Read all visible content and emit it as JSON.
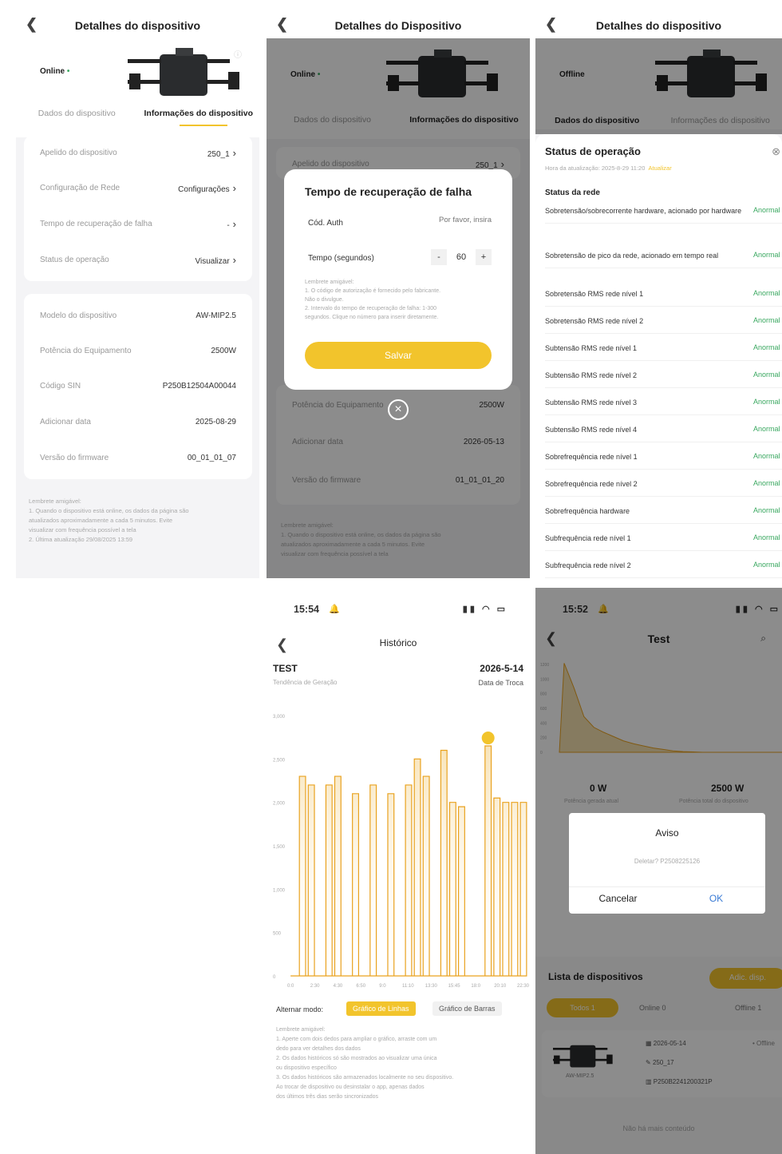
{
  "panel1": {
    "title": "Detalhes do dispositivo",
    "status": "Online",
    "tabs": [
      "Dados do dispositivo",
      "Informações do dispositivo"
    ],
    "rows1": [
      {
        "label": "Apelido do dispositivo",
        "value": "250_1"
      },
      {
        "label": "Configuração de Rede",
        "value": "Configurações"
      },
      {
        "label": "Tempo de recuperação de falha",
        "value": "-"
      },
      {
        "label": "Status de operação",
        "value": "Visualizar"
      }
    ],
    "rows2": [
      {
        "label": "Modelo do dispositivo",
        "value": "AW-MIP2.5"
      },
      {
        "label": "Potência do Equipamento",
        "value": "2500W"
      },
      {
        "label": "Código SIN",
        "value": "P250B12504A00044"
      },
      {
        "label": "Adicionar data",
        "value": "2025-08-29"
      },
      {
        "label": "Versão do firmware",
        "value": "00_01_01_07"
      }
    ],
    "hint_title": "Lembrete amigável:",
    "hint_lines": [
      "1. Quando o dispositivo está online, os dados da página são",
      "atualizados aproximadamente a cada 5 minutos. Evite",
      "visualizar com frequência possível a tela",
      "2. Última atualização 29/08/2025 13:59"
    ]
  },
  "panel2": {
    "title": "Detalhes do Dispositivo",
    "status": "Online",
    "tabs": [
      "Dados do dispositivo",
      "Informações do dispositivo"
    ],
    "bg_row": {
      "label": "Apelido do dispositivo",
      "value": "250_1"
    },
    "modal": {
      "title": "Tempo de recuperação de falha",
      "auth_label": "Cód. Auth",
      "auth_placeholder": "Por favor, insira",
      "time_label": "Tempo (segundos)",
      "time_value": "60",
      "minus": "-",
      "plus": "+",
      "hint_lines": [
        "Lembrete amigável:",
        "1. O código de autorização é fornecido pelo fabricante.",
        "Não o divulgue.",
        "2. Intervalo do tempo de recuperação de falha: 1-300",
        "segundos. Clique no número para inserir diretamente."
      ],
      "save": "Salvar"
    },
    "bg_rows": [
      {
        "label": "Potência do Equipamento",
        "value": "2500W"
      },
      {
        "label": "Adicionar data",
        "value": "2026-05-13"
      },
      {
        "label": "Versão do firmware",
        "value": "01_01_01_20"
      }
    ],
    "hint_lines": [
      "Lembrete amigável:",
      "1. Quando o dispositivo está online, os dados da página são",
      "atualizados aproximadamente a cada 5 minutos. Evite",
      "visualizar com frequência possível a tela"
    ]
  },
  "panel3": {
    "title": "Detalhes do dispositivo",
    "status": "Offline",
    "tabs": [
      "Dados do dispositivo",
      "Informações do dispositivo"
    ],
    "sheet_title": "Status de operação",
    "update_time": "Hora da atualização: 2025-8-29 11:20",
    "update_link": "Atualizar",
    "section": "Status da rede",
    "items": [
      "Sobretensão/sobrecorrente hardware, acionado por hardware",
      "Sobretensão de pico da rede, acionado em tempo real",
      "Sobretensão RMS rede nível 1",
      "Sobretensão RMS rede nível 2",
      "Subtensão RMS rede nível 1",
      "Subtensão RMS rede nível 2",
      "Subtensão RMS rede nível 3",
      "Subtensão RMS rede nível 4",
      "Sobrefrequência rede nível 1",
      "Sobrefrequência rede nível 2",
      "Sobrefrequência hardware",
      "Subfrequência rede nível 1",
      "Subfrequência rede nível 2"
    ],
    "item_status": "Anormal"
  },
  "panel4": {
    "time": "15:54",
    "title": "Histórico",
    "device": "TEST",
    "subtitle": "Tendência de Geração",
    "date": "2026-5-14",
    "date_sub": "Data de Troca",
    "mode_label": "Alternar modo:",
    "mode_line": "Gráfico de Linhas",
    "mode_bar": "Gráfico de Barras",
    "hint_lines": [
      "Lembrete amigável:",
      "1. Aperte com dois dedos para ampliar o gráfico, arraste com um",
      "dedo para ver detalhes dos dados",
      "2. Os dados históricos só são mostrados ao visualizar uma única",
      "ou dispositivo específico",
      "3. Os dados históricos são armazenados localmente no seu dispositivo.",
      "Ao trocar de dispositivo ou desinstalar o app, apenas dados",
      "dos últimos três dias serão sincronizados"
    ]
  },
  "panel5": {
    "time": "15:52",
    "title": "Test",
    "power_now": "0 W",
    "power_now_label": "Potência gerada atual",
    "power_total": "2500 W",
    "power_total_label": "Potência total do dispositivo",
    "dialog_title": "Aviso",
    "dialog_msg": "Deletar? P2508225126",
    "cancel": "Cancelar",
    "ok": "OK",
    "list_title": "Lista de dispositivos",
    "add_btn": "Adic. disp.",
    "filters": [
      "Todos 1",
      "Online 0",
      "Offline 1"
    ],
    "dev_date": "2026-05-14",
    "dev_name": "250_17",
    "dev_sn": "P250B2241200321P",
    "dev_model": "AW-MIP2.5",
    "dev_state": "Offline",
    "footer": "Não há mais conteúdo"
  },
  "chart_data": {
    "type": "area",
    "title": "",
    "xlabel": "",
    "ylabel": "",
    "ylim": [
      0,
      3000
    ],
    "yticks": [
      "3,000",
      "2,500",
      "2,000",
      "1,500",
      "1,000",
      "500",
      "0"
    ],
    "x": [
      "0:0",
      "2:30",
      "4:30",
      "6:50",
      "9:0",
      "11:10",
      "13:30",
      "15:45",
      "18:0",
      "20:10",
      "22:30"
    ],
    "series": [
      {
        "values": [
          0,
          2300,
          2200,
          0,
          2200,
          2300,
          0,
          2100,
          0,
          2200,
          0,
          2100,
          0,
          2200,
          2500,
          2300,
          0,
          2600,
          2000,
          1950,
          0,
          0,
          2650,
          2050,
          2000,
          2000,
          2000
        ]
      }
    ],
    "peak_marker": true
  },
  "chart2_data": {
    "type": "area",
    "yticks": [
      "1200",
      "1000",
      "800",
      "600",
      "400",
      "200",
      "0"
    ],
    "series": [
      {
        "values": [
          1250,
          900,
          500,
          350,
          280,
          220,
          160,
          120,
          90,
          60,
          40,
          20,
          10,
          5,
          0,
          0,
          0,
          0,
          0,
          0,
          0,
          0,
          0
        ]
      }
    ]
  },
  "colors": {
    "accent": "#f2c42c",
    "online": "#3aa860",
    "anormal": "#3aa860",
    "chart": "#e9a21f"
  }
}
